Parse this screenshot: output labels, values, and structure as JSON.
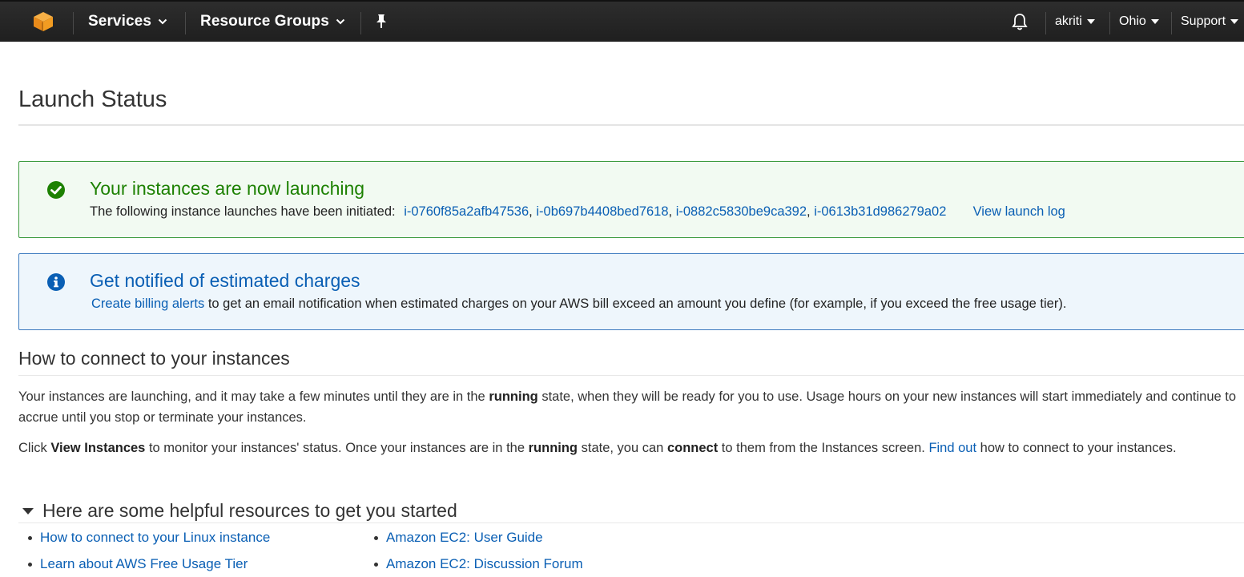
{
  "nav": {
    "services_label": "Services",
    "resource_groups_label": "Resource Groups",
    "user_label": "akriti",
    "region_label": "Ohio",
    "support_label": "Support",
    "brand_color": "#ff9900",
    "icons": [
      "aws-logo-icon",
      "chevron-down-icon",
      "pin-icon",
      "bell-icon",
      "caret-down-icon"
    ]
  },
  "page": {
    "title": "Launch Status"
  },
  "success_alert": {
    "title": "Your instances are now launching",
    "body_prefix": "The following instance launches have been initiated:",
    "instance_ids": [
      "i-0760f85a2afb47536",
      "i-0b697b4408bed7618",
      "i-0882c5830be9ca392",
      "i-0613b31d986279a02"
    ],
    "separator": ",",
    "view_log_label": "View launch log",
    "color": "#1d8102"
  },
  "info_alert": {
    "title": "Get notified of estimated charges",
    "link_label": "Create billing alerts",
    "body_rest": "to get an email notification when estimated charges on your AWS bill exceed an amount you define (for example, if you exceed the free usage tier).",
    "color": "#0a5fb4"
  },
  "connect": {
    "heading": "How to connect to your instances",
    "p1_a": "Your instances are launching, and it may take a few minutes until they are in the",
    "p1_bold": "running",
    "p1_b": "state, when they will be ready for you to use. Usage hours on your new instances will start immediately and continue to accrue until you stop or terminate your instances.",
    "p2_a": "Click",
    "p2_bold1": "View Instances",
    "p2_b": "to monitor your instances' status. Once your instances are in the",
    "p2_bold2": "running",
    "p2_c": "state, you can",
    "p2_bold3": "connect",
    "p2_d": "to them from the Instances screen.",
    "p2_link": "Find out",
    "p2_e": "how to connect to your instances."
  },
  "resources": {
    "heading": "Here are some helpful resources to get you started",
    "col1": [
      "How to connect to your Linux instance",
      "Learn about AWS Free Usage Tier"
    ],
    "col2": [
      "Amazon EC2: User Guide",
      "Amazon EC2: Discussion Forum"
    ]
  }
}
